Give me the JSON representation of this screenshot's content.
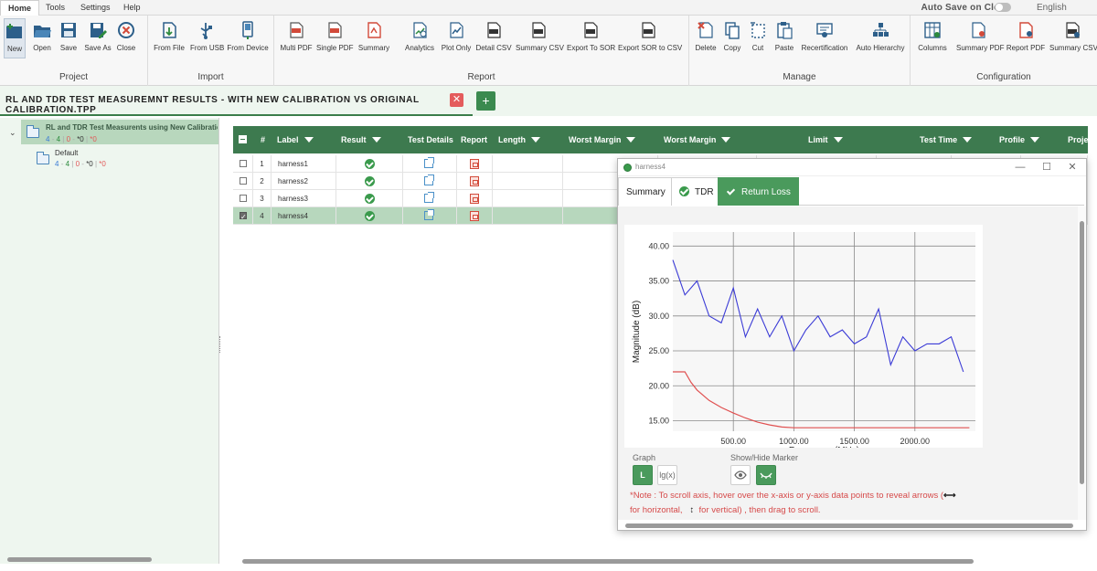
{
  "menu": {
    "tabs": [
      "Home",
      "Tools",
      "Settings",
      "Help"
    ],
    "autosave_label": "Auto Save on Close",
    "language": "English"
  },
  "ribbon": {
    "groups": {
      "project": {
        "label": "Project",
        "buttons": [
          "New",
          "Open",
          "Save",
          "Save As",
          "Close"
        ]
      },
      "import": {
        "label": "Import",
        "buttons": [
          "From File",
          "From USB",
          "From Device"
        ]
      },
      "report": {
        "label": "Report",
        "buttons": [
          "Multi PDF",
          "Single PDF",
          "Summary",
          "Analytics",
          "Plot Only",
          "Detail CSV",
          "Summary CSV",
          "Export To SOR",
          "Export SOR to CSV"
        ]
      },
      "manage": {
        "label": "Manage",
        "buttons": [
          "Delete",
          "Copy",
          "Cut",
          "Paste",
          "Recertification",
          "Auto Hierarchy"
        ]
      },
      "configuration": {
        "label": "Configuration",
        "buttons": [
          "Columns",
          "Summary PDF",
          "Report PDF",
          "Summary CSV"
        ]
      }
    }
  },
  "file_tab": {
    "title": "RL AND TDR TEST MEASUREMNT RESULTS - WITH NEW CALIBRATION VS ORIGINAL CALIBRATION.TPP",
    "close_glyph": "✕",
    "add_glyph": "+"
  },
  "tree": {
    "caret": "⌄",
    "root": {
      "name": "RL and TDR Test Measurents using New Calibration",
      "counts": {
        "total": "4",
        "sep1": "-",
        "pass": "4",
        "bar": "|",
        "fail": "0",
        "sep2": "-",
        "marked": "*0",
        "bar2": "|",
        "warn": "*0"
      }
    },
    "child": {
      "name": "Default",
      "counts": {
        "total": "4",
        "sep1": "-",
        "pass": "4",
        "bar": "|",
        "fail": "0",
        "sep2": "-",
        "marked": "*0",
        "bar2": "|",
        "warn": "*0"
      }
    }
  },
  "grid": {
    "headers": {
      "num": "#",
      "label": "Label",
      "result": "Result",
      "test_details": "Test Details",
      "report": "Report",
      "length": "Length",
      "worst_margin_1": "Worst Margin",
      "worst_margin_2": "Worst Margin",
      "limit": "Limit",
      "test_time": "Test Time",
      "profile": "Profile",
      "project": "Proje"
    },
    "rows": [
      {
        "num": "1",
        "label": "harness1",
        "checked": false,
        "selected": false
      },
      {
        "num": "2",
        "label": "harness2",
        "checked": false,
        "selected": false
      },
      {
        "num": "3",
        "label": "harness3",
        "checked": false,
        "selected": false
      },
      {
        "num": "4",
        "label": "harness4",
        "checked": true,
        "selected": true
      }
    ]
  },
  "window": {
    "title": "harness4",
    "tabs": [
      "Summary",
      "TDR",
      "Return Loss"
    ],
    "active_tab": "Return Loss",
    "controls": {
      "graph_label": "Graph",
      "graph_linear": "L",
      "graph_log": "lg(x)",
      "marker_label": "Show/Hide Marker"
    },
    "note_line1_a": "*Note : To scroll axis, hover over the x-axis or y-axis data points to reveal arrows (",
    "note_line1_arrow": "⟷",
    "note_line2_a": "for horizontal,",
    "note_line2_arrow": "↕",
    "note_line2_b": "for vertical) , then drag to scroll."
  },
  "colors": {
    "accent_green": "#3d7a4f",
    "selection_green": "#b7d7bd",
    "data_series": "#3b3bd6",
    "limit_series": "#e05050",
    "note_red": "#d64a4a"
  },
  "chart_data": {
    "type": "line",
    "title": "",
    "ylabel": "Magnitude (dB)",
    "xlabel": "Frequency (MHz)",
    "xlim": [
      0,
      2500
    ],
    "ylim": [
      13.5,
      42
    ],
    "xticks": [
      "500.00",
      "1000.00",
      "1500.00",
      "2000.00"
    ],
    "xtick_values": [
      500,
      1000,
      1500,
      2000
    ],
    "yticks": [
      "15.00",
      "20.00",
      "25.00",
      "30.00",
      "35.00",
      "40.00"
    ],
    "ytick_values": [
      15,
      20,
      25,
      30,
      35,
      40
    ],
    "series": [
      {
        "color": "#3b3bd6",
        "x": [
          0,
          100,
          200,
          300,
          400,
          500,
          600,
          700,
          800,
          900,
          1000,
          1100,
          1200,
          1300,
          1400,
          1500,
          1600,
          1700,
          1800,
          1900,
          2000,
          2100,
          2200,
          2300,
          2400
        ],
        "y": [
          38,
          33,
          35,
          30,
          29,
          34,
          27,
          31,
          27,
          30,
          25,
          28,
          30,
          27,
          28,
          26,
          27,
          31,
          23,
          27,
          25,
          26,
          26,
          27,
          22
        ]
      },
      {
        "color": "#e05050",
        "x": [
          0,
          100,
          150,
          200,
          300,
          400,
          500,
          600,
          700,
          800,
          900,
          1000,
          1200,
          1500,
          2000,
          2450
        ],
        "y": [
          22,
          22,
          20.5,
          19.4,
          17.9,
          16.9,
          16.1,
          15.4,
          14.8,
          14.4,
          14.1,
          14,
          14,
          14,
          14,
          14
        ]
      }
    ]
  }
}
